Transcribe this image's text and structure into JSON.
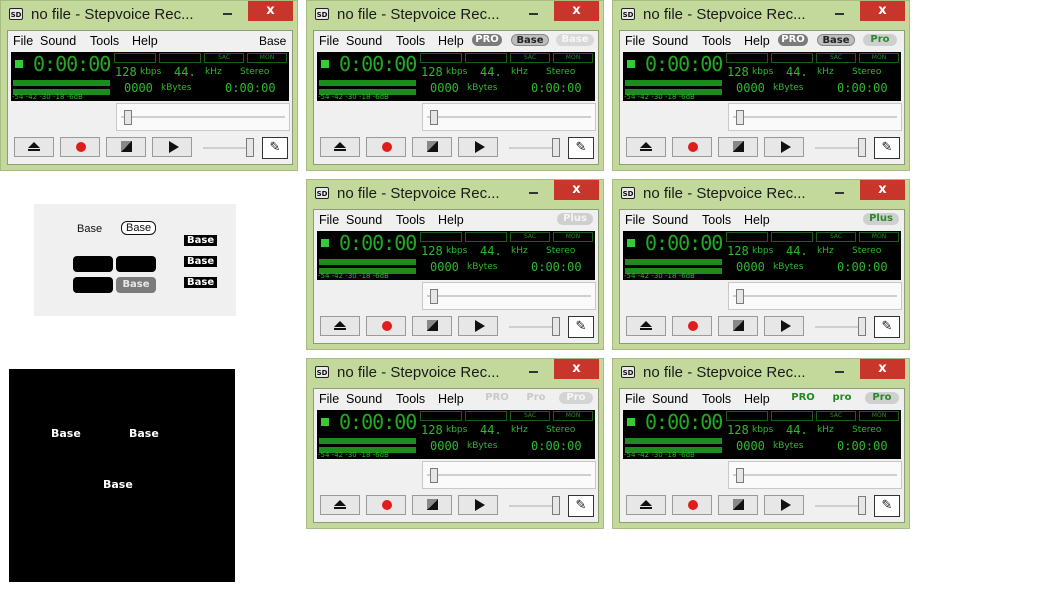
{
  "window": {
    "title": "no file - Stepvoice Rec...",
    "close_label": "x",
    "icon": "sd-app-icon",
    "menu": [
      "File",
      "Sound",
      "Tools",
      "Help"
    ],
    "display": {
      "timer": "0:00:00",
      "kbps": "128",
      "kbps_label": "kbps",
      "khz": "44.",
      "khz_label": "kHz",
      "mode": "Stereo",
      "kbytes": "0000",
      "kbytes_label": "kBytes",
      "elapsed": "0:00:00",
      "sac": "SAC",
      "mon": "MON",
      "db_scale": "-54 -42 -30 -18 -6dB"
    },
    "buttons": {
      "eject": "eject-icon",
      "record": "record-icon",
      "stop": "stop-icon",
      "play": "play-icon",
      "mic": "microphone-settings-icon"
    }
  },
  "variants": [
    {
      "id": "w1",
      "badges": [
        "Base"
      ]
    },
    {
      "id": "w2",
      "badges": [
        "PRO",
        "Base",
        "Base"
      ]
    },
    {
      "id": "w3",
      "badges": [
        "PRO",
        "Base",
        "Pro"
      ]
    },
    {
      "id": "w4",
      "badges": [
        "Plus"
      ]
    },
    {
      "id": "w5",
      "badges": [
        "Plus"
      ]
    },
    {
      "id": "w6",
      "badges": [
        "PRO",
        "Pro",
        "Pro"
      ]
    },
    {
      "id": "w7",
      "badges": [
        "PRO",
        "pro",
        "Pro"
      ]
    }
  ],
  "samples": {
    "plain": "Base",
    "outline": "Base",
    "black1": "Base",
    "black2": "Base",
    "black3": "Base",
    "gray_pill": "Base"
  },
  "black_panel": {
    "a": "Base",
    "b": "Base",
    "c": "Base"
  }
}
